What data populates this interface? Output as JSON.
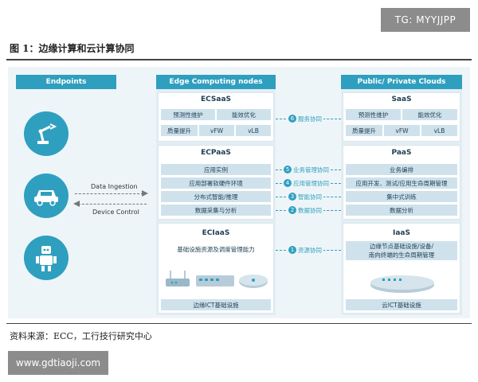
{
  "watermark_top": "TG: MYYJJPP",
  "figure_title": "图 1：边缘计算和云计算协同",
  "columns": {
    "endpoints": "Endpoints",
    "edge": "Edge Computing nodes",
    "cloud": "Public/ Private Clouds"
  },
  "edge": {
    "ecsaas": {
      "title": "ECSaaS",
      "row1": [
        "预测性维护",
        "能效优化"
      ],
      "row2": [
        "质量提升",
        "vFW",
        "vLB"
      ]
    },
    "ecpaas": {
      "title": "ECPaaS",
      "rows": [
        "应用实例",
        "应用部署软硬件环境",
        "分布式智能/推理",
        "数据采集与分析"
      ]
    },
    "eciaas": {
      "title": "ECIaaS",
      "subtitle": "基础设施资源及调度管理能力",
      "footer": "边缘ICT基础设施"
    }
  },
  "cloud": {
    "saas": {
      "title": "SaaS",
      "row1": [
        "预测性维护",
        "能效优化"
      ],
      "row2": [
        "质量提升",
        "vFW",
        "vLB"
      ]
    },
    "paas": {
      "title": "PaaS",
      "rows": [
        "业务编排",
        "应用开发、测试/应用生命周期管理",
        "集中式训练",
        "数据分析"
      ]
    },
    "iaas": {
      "title": "IaaS",
      "box_line1": "边缘节点基础设施/设备/",
      "box_line2": "南向终端的生命周期管理",
      "footer": "云ICT基础设施"
    }
  },
  "collab": {
    "service": {
      "num": "6",
      "label": "服务协同"
    },
    "biz": {
      "num": "5",
      "label": "业务管理协同"
    },
    "app": {
      "num": "4",
      "label": "应用管理协同"
    },
    "intel": {
      "num": "3",
      "label": "智能协同"
    },
    "data": {
      "num": "2",
      "label": "数据协同"
    },
    "resource": {
      "num": "1",
      "label": "资源协同"
    }
  },
  "endpoint_links": {
    "ingestion": "Data Ingestion",
    "control": "Device Control"
  },
  "icons": [
    "robot-arm-icon",
    "car-icon",
    "robot-icon",
    "router-icon",
    "switch-icon",
    "server-icon",
    "cloud-server-icon"
  ],
  "colors": {
    "accent": "#2f9fbf",
    "panel": "#eef5f8",
    "cell": "#cfe2ec"
  },
  "source": "资料来源：ECC，工行技行研究中心",
  "watermark_bottom": "www.gdtiaoji.com"
}
